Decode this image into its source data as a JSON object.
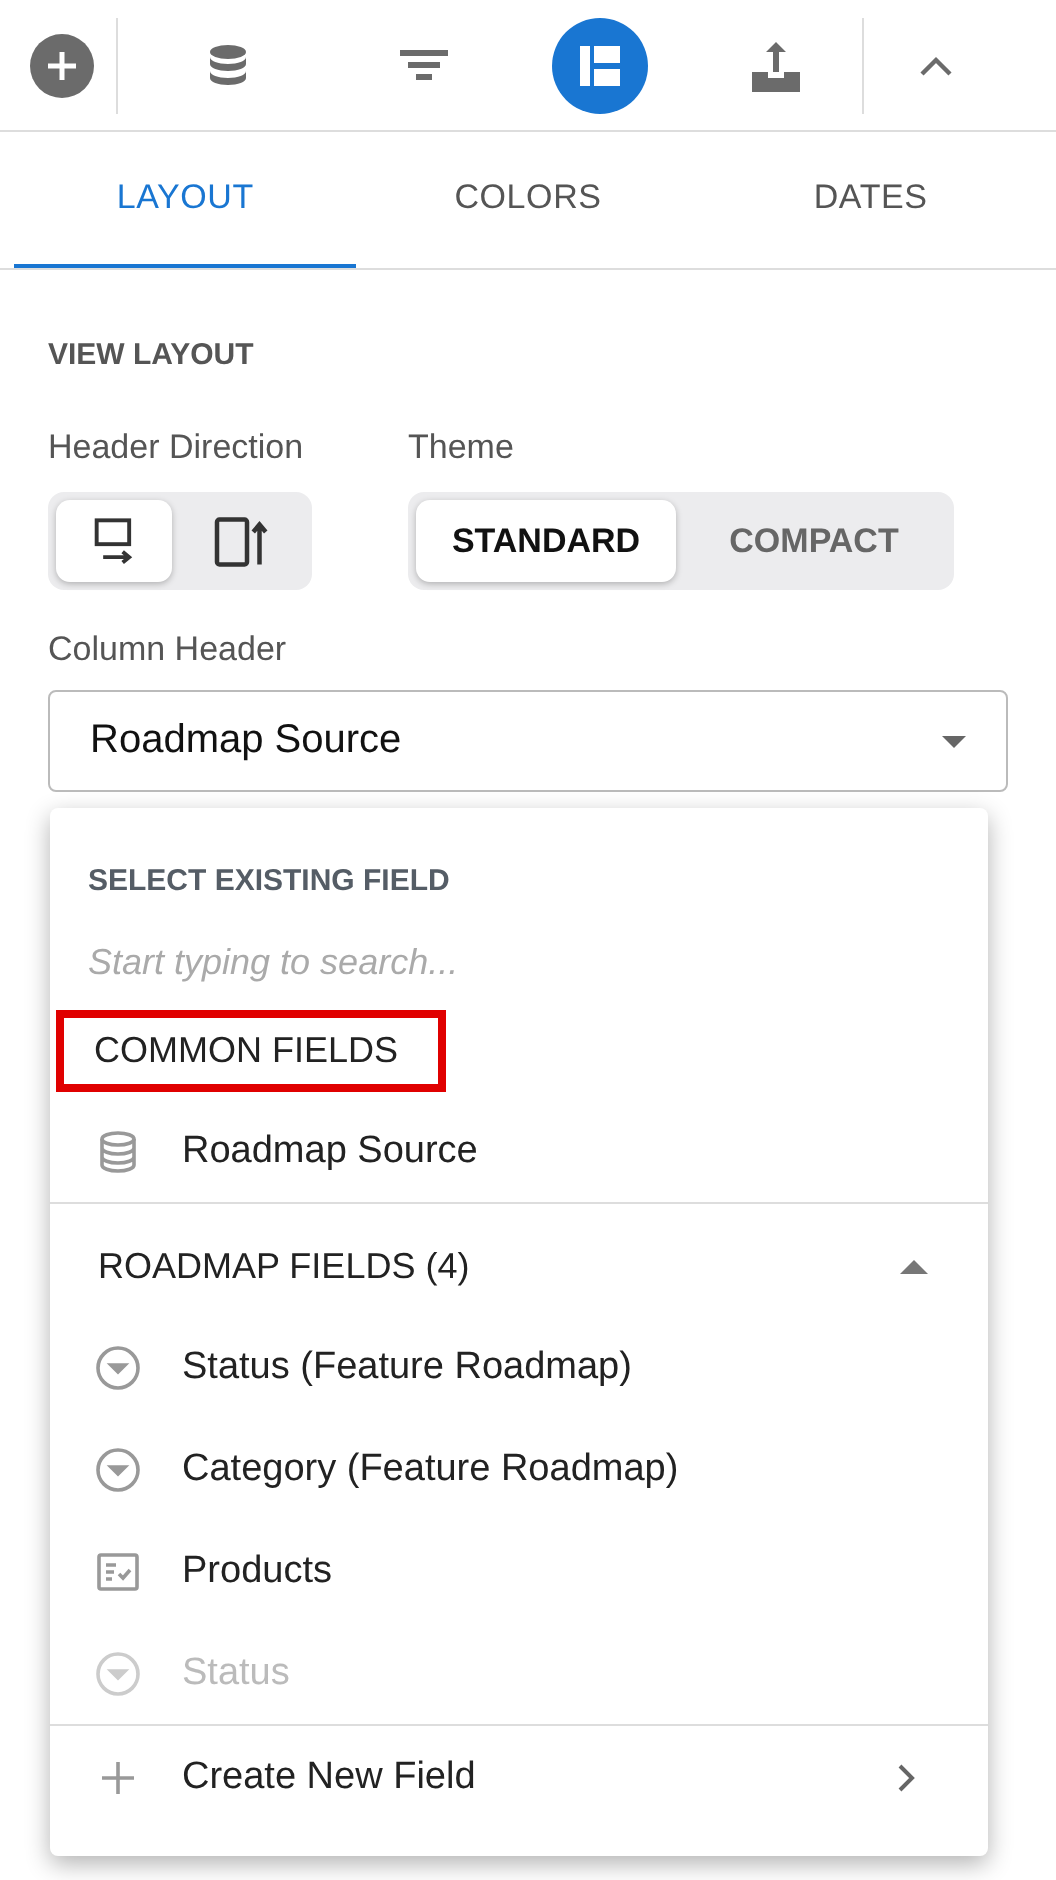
{
  "toolbar": [
    {
      "kind": "add",
      "selected": false
    },
    {
      "kind": "divider"
    },
    {
      "kind": "database",
      "selected": false
    },
    {
      "kind": "filter",
      "selected": false
    },
    {
      "kind": "layout",
      "selected": true
    },
    {
      "kind": "upload",
      "selected": false
    },
    {
      "kind": "divider"
    },
    {
      "kind": "collapse",
      "selected": false
    }
  ],
  "tabs": [
    {
      "label": "LAYOUT",
      "selected": true
    },
    {
      "label": "COLORS",
      "selected": false
    },
    {
      "label": "DATES",
      "selected": false
    }
  ],
  "section_title": "VIEW LAYOUT",
  "header_direction": {
    "label": "Header Direction",
    "options": [
      {
        "kind": "horizontal",
        "selected": true
      },
      {
        "kind": "vertical",
        "selected": false
      }
    ]
  },
  "theme": {
    "label": "Theme",
    "options": [
      {
        "label": "STANDARD",
        "selected": true
      },
      {
        "label": "COMPACT",
        "selected": false
      }
    ]
  },
  "column_header": {
    "label": "Column Header",
    "value": "Roadmap Source"
  },
  "dropdown": {
    "title": "SELECT EXISTING FIELD",
    "search": {
      "placeholder": "Start typing to search..."
    },
    "groups": [
      {
        "label": "COMMON FIELDS",
        "highlighted": true,
        "items": [
          {
            "kind": "database",
            "label": "Roadmap Source",
            "disabled": false
          }
        ]
      },
      {
        "label": "ROADMAP FIELDS (4)",
        "expanded": true,
        "items": [
          {
            "kind": "select",
            "label": "Status (Feature Roadmap)",
            "disabled": false
          },
          {
            "kind": "select",
            "label": "Category (Feature Roadmap)",
            "disabled": false
          },
          {
            "kind": "checklist",
            "label": "Products",
            "disabled": false
          },
          {
            "kind": "select",
            "label": "Status",
            "disabled": true
          }
        ]
      }
    ],
    "create": {
      "label": "Create New Field"
    }
  }
}
